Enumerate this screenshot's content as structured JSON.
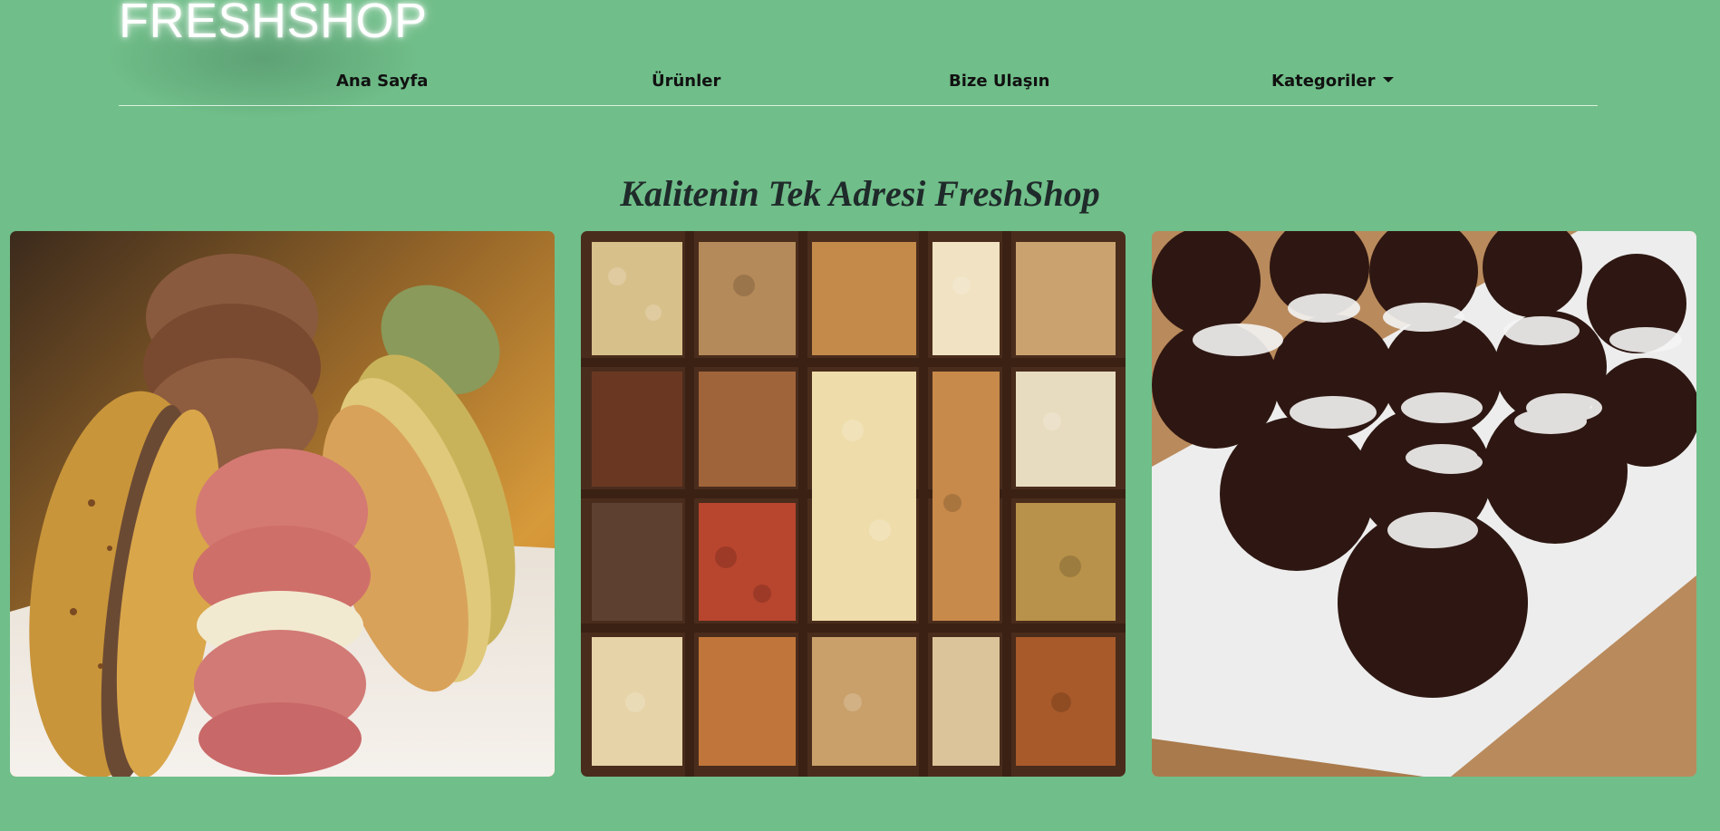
{
  "brand": {
    "name": "FRESHSHOP"
  },
  "nav": {
    "items": [
      {
        "label": "Ana Sayfa"
      },
      {
        "label": "Ürünler"
      },
      {
        "label": "Bize Ulaşın"
      },
      {
        "label": "Kategoriler"
      }
    ]
  },
  "hero": {
    "headline": "Kalitenin Tek Adresi FreshShop"
  },
  "gallery": {
    "images": [
      {
        "subject": "macarons"
      },
      {
        "subject": "nuts-assortment-box"
      },
      {
        "subject": "chocolate-coconut-cookies"
      }
    ]
  },
  "colors": {
    "background": "#70be89",
    "nav_text": "#111111",
    "headline_text": "#1f2a2a",
    "brand_text": "#ffffff"
  }
}
